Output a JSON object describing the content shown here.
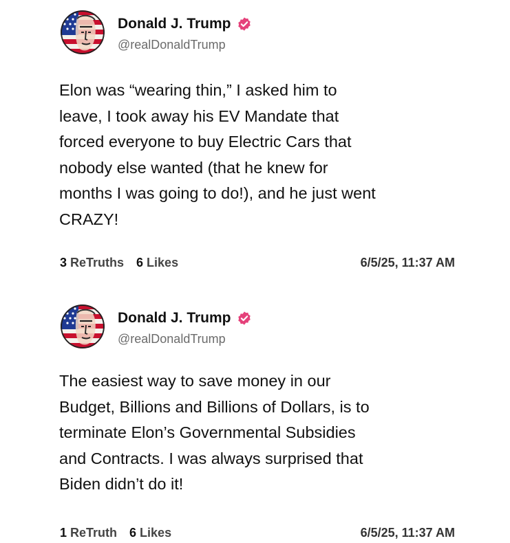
{
  "colors": {
    "verified_badge": "#e5417a",
    "flag_red": "#c8102e",
    "flag_blue": "#1f3a93",
    "text_primary": "#111111",
    "text_secondary": "#6b6b6b"
  },
  "posts": [
    {
      "author": {
        "name": "Donald J. Trump",
        "handle": "@realDonaldTrump",
        "avatar_icon": "flag-portrait-avatar",
        "verified_icon": "verified-badge-icon"
      },
      "lines": [
        "Elon was “wearing thin,” I asked him to",
        "leave, I took away his EV Mandate that",
        "forced everyone to buy Electric Cars that",
        "nobody else wanted (that he knew for",
        "months I was going to do!), and he just went",
        "CRAZY!"
      ],
      "retruths_count": "3",
      "retruths_label": "ReTruths",
      "likes_count": "6",
      "likes_label": "Likes",
      "timestamp": "6/5/25, 11:37 AM"
    },
    {
      "author": {
        "name": "Donald J. Trump",
        "handle": "@realDonaldTrump",
        "avatar_icon": "flag-portrait-avatar",
        "verified_icon": "verified-badge-icon"
      },
      "lines": [
        "The easiest way to save money in our",
        "Budget, Billions and Billions of Dollars, is to",
        "terminate Elon’s Governmental Subsidies",
        "and Contracts. I was always surprised that",
        "Biden didn’t do it!"
      ],
      "retruths_count": "1",
      "retruths_label": "ReTruth",
      "likes_count": "6",
      "likes_label": "Likes",
      "timestamp": "6/5/25, 11:37 AM"
    }
  ]
}
